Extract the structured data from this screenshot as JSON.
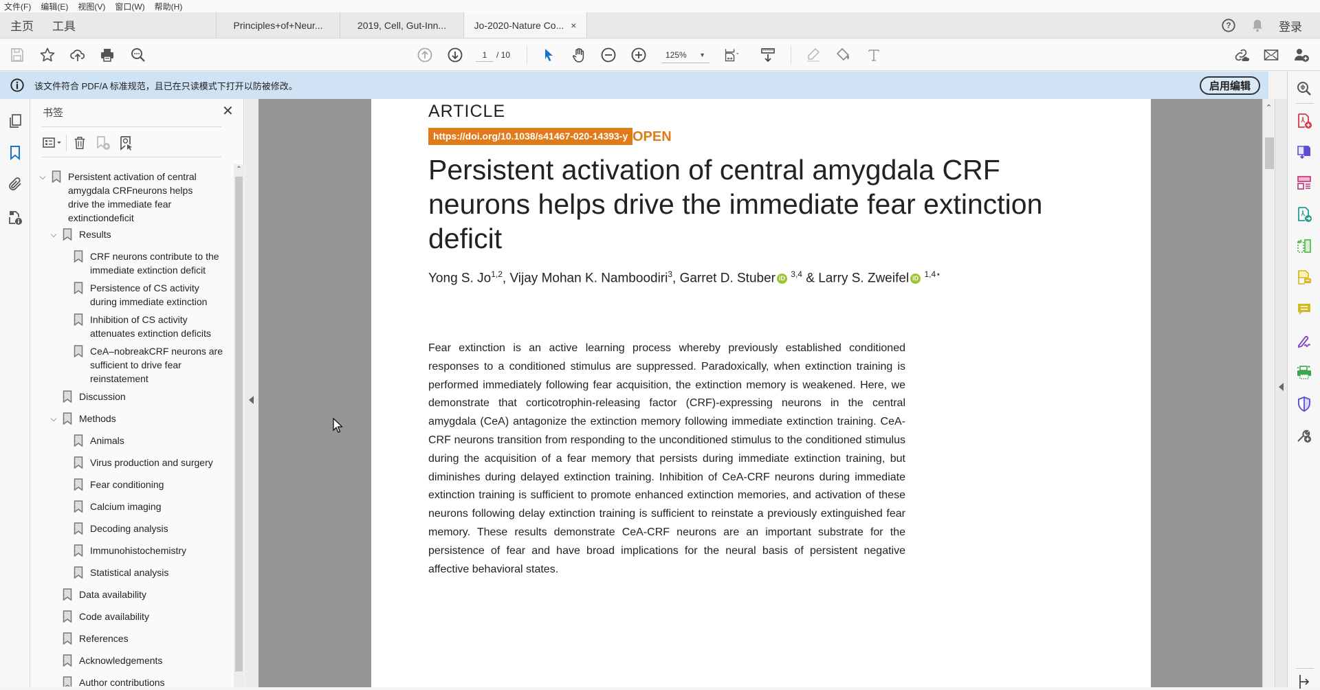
{
  "menubar": {
    "items": [
      "文件(F)",
      "编辑(E)",
      "视图(V)",
      "窗口(W)",
      "帮助(H)"
    ]
  },
  "tabbar": {
    "home": "主页",
    "tools": "工具",
    "doc_tabs": [
      {
        "label": "Principles+of+Neur...",
        "active": false
      },
      {
        "label": "2019, Cell, Gut-Inn...",
        "active": false
      },
      {
        "label": "Jo-2020-Nature Co...",
        "active": true,
        "close": "×"
      }
    ],
    "login": "登录",
    "icons": [
      "help-icon",
      "bell-icon"
    ]
  },
  "toolbar": {
    "left_icons": [
      "save-icon",
      "star-icon",
      "cloud-upload-icon",
      "print-icon",
      "search-more-icon"
    ],
    "current_page": "1",
    "total_pages": "/ 10",
    "zoom": "125%",
    "right_icons": [
      "share-link-icon",
      "email-icon",
      "add-user-icon"
    ]
  },
  "infobar": {
    "message": "该文件符合 PDF/A 标准规范，且已在只读模式下打开以防被修改。",
    "button": "启用编辑"
  },
  "bookmarks": {
    "title": "书签",
    "close": "✕",
    "items": [
      {
        "level": 0,
        "expanded": true,
        "label": "Persistent activation of central amygdala CRFneurons helps drive the immediate fear extinctiondeficit"
      },
      {
        "level": 1,
        "expanded": true,
        "label": "Results"
      },
      {
        "level": 2,
        "label": "CRF neurons contribute to the immediate extinction deficit"
      },
      {
        "level": 2,
        "label": "Persistence of CS activity during immediate extinction"
      },
      {
        "level": 2,
        "label": "Inhibition of CS activity attenuates extinction deficits"
      },
      {
        "level": 2,
        "label": "CeA–nobreakCRF neurons are sufficient to drive fear reinstatement"
      },
      {
        "level": 1,
        "label": "Discussion"
      },
      {
        "level": 1,
        "expanded": true,
        "label": "Methods"
      },
      {
        "level": 2,
        "label": "Animals"
      },
      {
        "level": 2,
        "label": "Virus production and surgery"
      },
      {
        "level": 2,
        "label": "Fear conditioning"
      },
      {
        "level": 2,
        "label": "Calcium imaging"
      },
      {
        "level": 2,
        "label": "Decoding analysis"
      },
      {
        "level": 2,
        "label": "Immunohistochemistry"
      },
      {
        "level": 2,
        "label": "Statistical analysis"
      },
      {
        "level": 1,
        "label": "Data availability"
      },
      {
        "level": 1,
        "label": "Code availability"
      },
      {
        "level": 1,
        "label": "References"
      },
      {
        "level": 1,
        "label": "Acknowledgements"
      },
      {
        "level": 1,
        "label": "Author contributions"
      }
    ]
  },
  "document": {
    "article_label": "ARTICLE",
    "doi": "https://doi.org/10.1038/s41467-020-14393-y",
    "open_label": "OPEN",
    "title": "Persistent activation of central amygdala CRF neurons helps drive the immediate fear extinction deficit",
    "authors": [
      {
        "name": "Yong S. Jo",
        "aff": "1,2",
        "orcid": false,
        "sep": ", "
      },
      {
        "name": "Vijay Mohan K. Namboodiri",
        "aff": "3",
        "orcid": false,
        "sep": ", "
      },
      {
        "name": "Garret D. Stuber",
        "aff": "3,4",
        "orcid": true,
        "sep": " & "
      },
      {
        "name": "Larry S. Zweifel",
        "aff": "1,4⋆",
        "orcid": true,
        "sep": ""
      }
    ],
    "abstract": "Fear extinction is an active learning process whereby previously established conditioned responses to a conditioned stimulus are suppressed. Paradoxically, when extinction training is performed immediately following fear acquisition, the extinction memory is weakened. Here, we demonstrate that corticotrophin-releasing factor (CRF)-expressing neurons in the central amygdala (CeA) antagonize the extinction memory following immediate extinction training. CeA-CRF neurons transition from responding to the unconditioned stimulus to the conditioned stimulus during the acquisition of a fear memory that persists during immediate extinction training, but diminishes during delayed extinction training. Inhibition of CeA-CRF neurons during immediate extinction training is sufficient to promote enhanced extinction memories, and activation of these neurons following delay extinction training is sufficient to reinstate a previously extinguished fear memory. These results demonstrate CeA-CRF neu­rons are an important substrate for the persistence of fear and have broad implications for the neural basis of persistent negative affective behavioral states."
  },
  "colors": {
    "accent_orange": "#e07b1a",
    "info_blue": "#cfe3f4",
    "orcid_green": "#9bc433",
    "select_blue": "#1a73c8"
  }
}
